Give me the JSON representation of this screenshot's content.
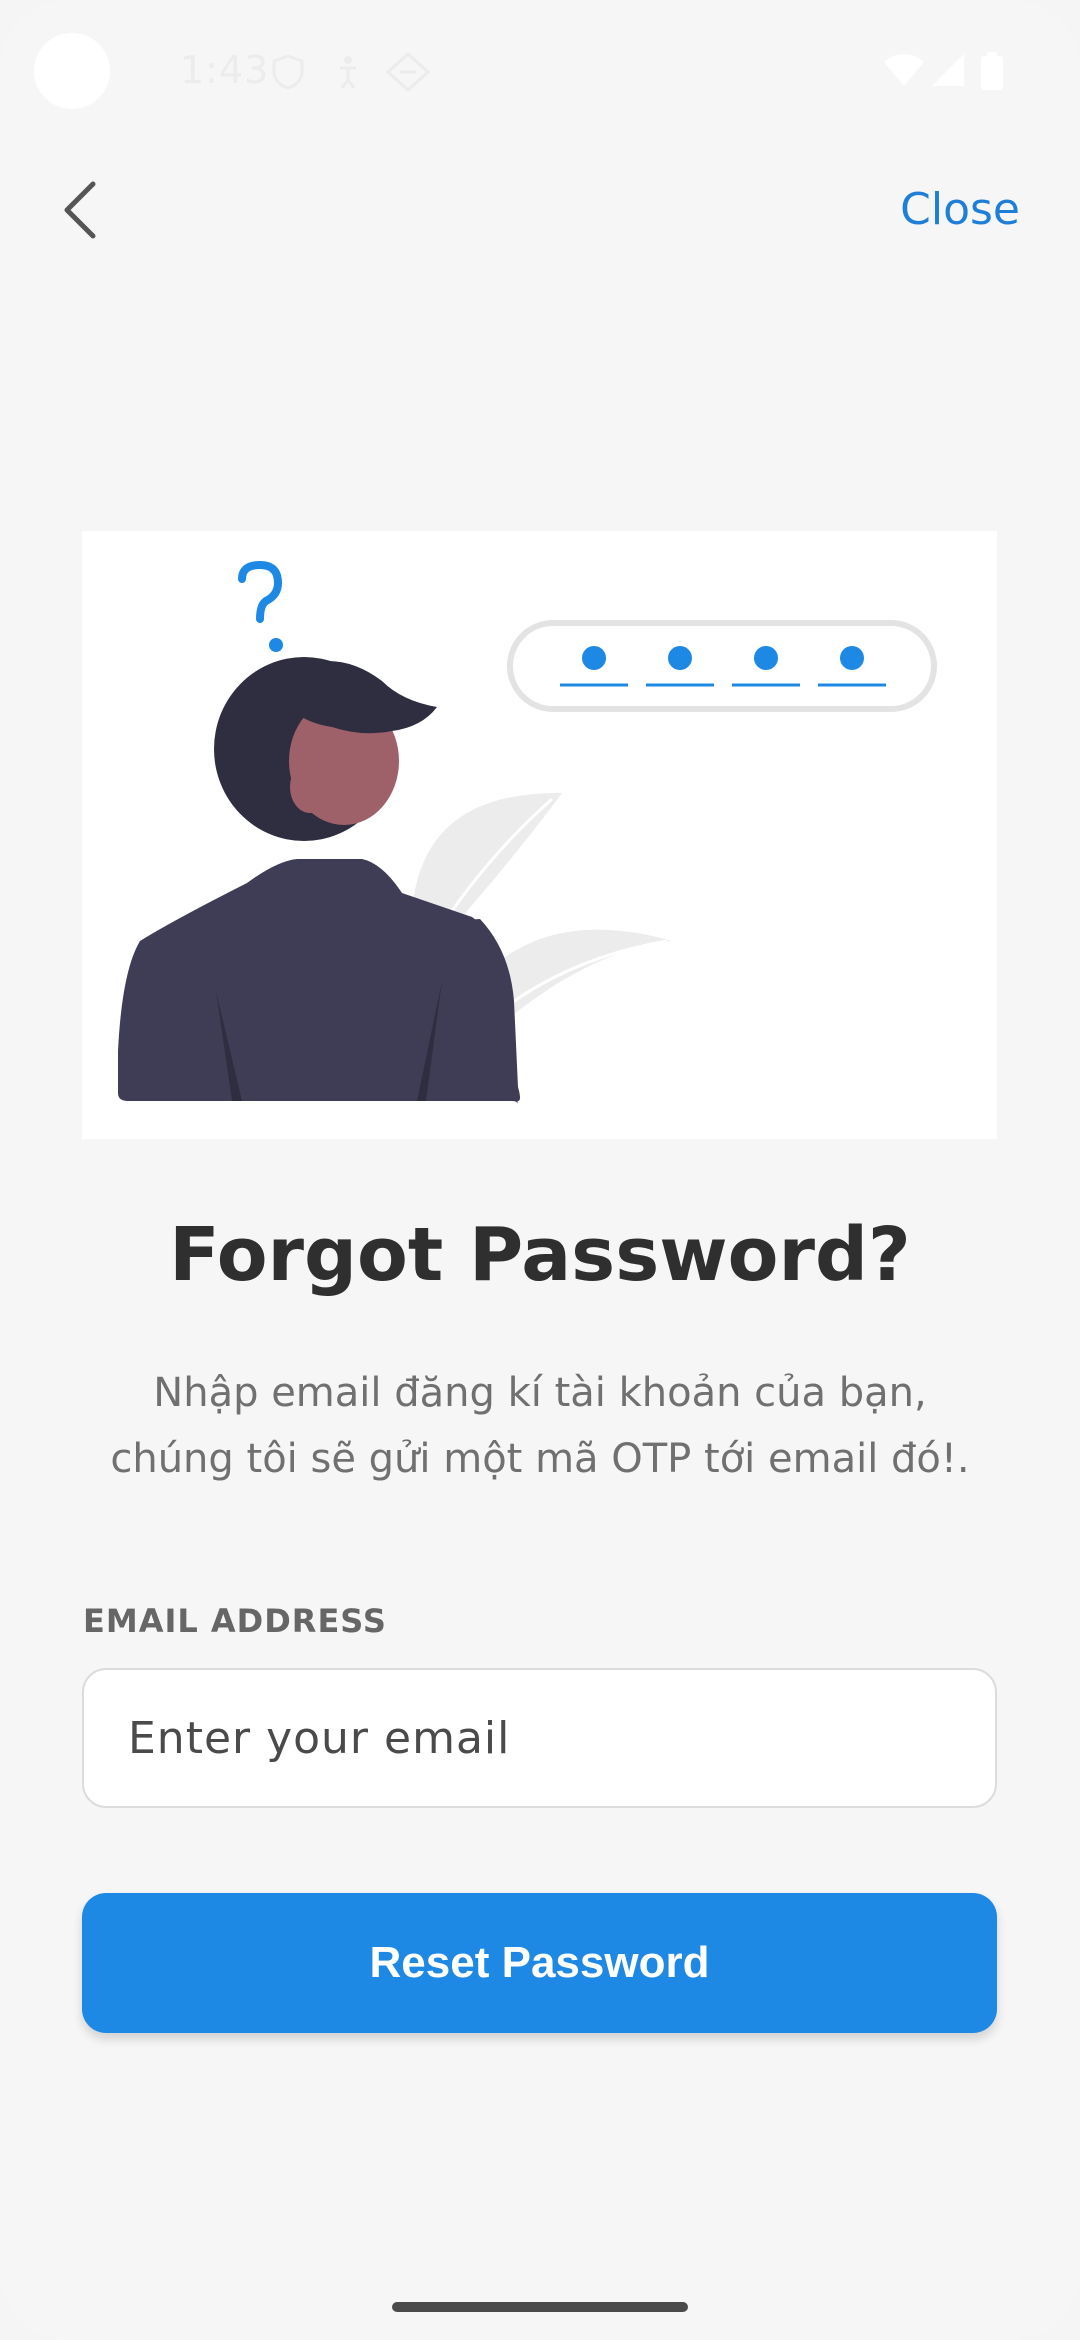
{
  "status_bar": {
    "time": "1:43",
    "icons": [
      "shield-icon",
      "accessibility-icon",
      "diamond-icon",
      "wifi-icon",
      "signal-icon",
      "battery-icon"
    ]
  },
  "nav": {
    "back_icon": "chevron-left-icon",
    "close_label": "Close"
  },
  "illustration": {
    "otp_dot_count": 4,
    "question_mark": "?"
  },
  "content": {
    "title": "Forgot Password?",
    "subtitle_line1": "Nhập email đăng kí tài khoản của bạn,",
    "subtitle_line2": "chúng tôi sẽ gửi một mã OTP tới email đó!."
  },
  "form": {
    "email_label": "EMAIL ADDRESS",
    "email_placeholder": "Enter your email",
    "email_value": "",
    "submit_label": "Reset Password"
  },
  "colors": {
    "accent": "#1e88e5",
    "link": "#1f7fd8",
    "title": "#2f2f2f",
    "background": "#f6f6f6"
  }
}
